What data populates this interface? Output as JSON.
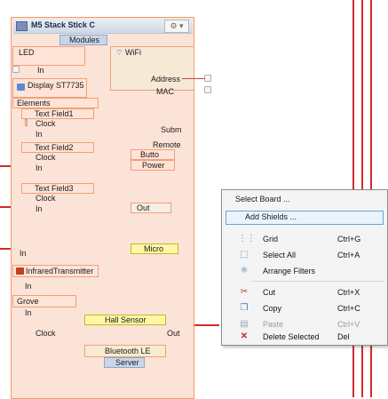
{
  "board": {
    "title": "M5 Stack Stick C",
    "modules_label": "Modules",
    "wifi_label": "WiFi",
    "address_label": "Address",
    "mac_label": "MAC"
  },
  "components": [
    {
      "name": "LED",
      "in": "In"
    },
    {
      "name": "Display ST7735",
      "elements": "Elements",
      "field1": "Text Field1",
      "clock1": "Clock",
      "in1": "In",
      "field2": "Text Field2",
      "clock2": "Clock",
      "in2": "In",
      "field3": "Text Field3",
      "clock3": "Clock",
      "in3": "In",
      "in4": "In"
    },
    {
      "name": "InfraredTransmitter",
      "in": "In"
    },
    {
      "name": "Grove",
      "in": "In"
    },
    {
      "name": "Hall Sensor",
      "clock": "Clock",
      "out": "Out"
    },
    {
      "name": "Bluetooth LE",
      "server": "Server"
    }
  ],
  "side_labels": {
    "subm": "Subm",
    "remote": "Remote",
    "button": "Butto",
    "power": "Power",
    "out": "Out",
    "micro": "Micro"
  },
  "context_menu": {
    "select_board": "Select Board ...",
    "add_shields": "Add Shields ...",
    "items": [
      {
        "label": "Grid",
        "shortcut": "Ctrl+G",
        "icon": "grid-icon",
        "enabled": true
      },
      {
        "label": "Select All",
        "shortcut": "Ctrl+A",
        "icon": "select-all-icon",
        "enabled": true
      },
      {
        "label": "Arrange Filters",
        "shortcut": "",
        "icon": "arrange-filters-icon",
        "enabled": true
      },
      {
        "label": "Cut",
        "shortcut": "Ctrl+X",
        "icon": "cut-icon",
        "enabled": true
      },
      {
        "label": "Copy",
        "shortcut": "Ctrl+C",
        "icon": "copy-icon",
        "enabled": true
      },
      {
        "label": "Paste",
        "shortcut": "Ctrl+V",
        "icon": "paste-icon",
        "enabled": false
      },
      {
        "label": "Delete Selected",
        "shortcut": "Del",
        "icon": "delete-icon",
        "enabled": true
      }
    ]
  },
  "colors": {
    "wire": "#d22b2b",
    "component_fill": "#ffe3d6",
    "menu_bg": "#f4f4f4",
    "highlight_border": "#6aa3d9"
  }
}
